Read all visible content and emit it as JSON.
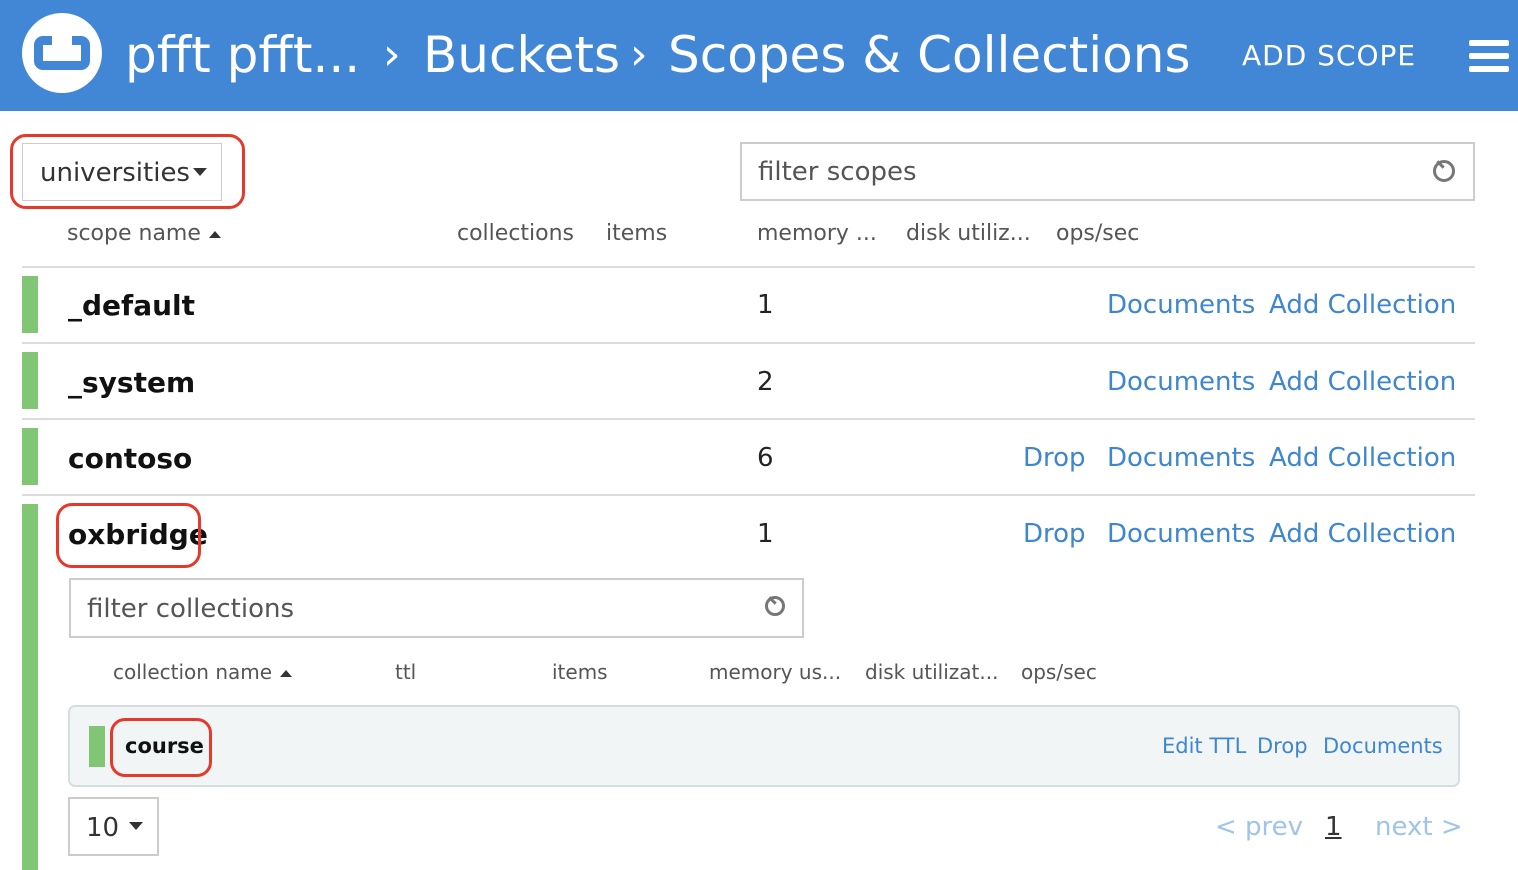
{
  "header": {
    "crumbs": [
      "pfft pfft...",
      "Buckets",
      "Scopes & Collections"
    ],
    "add_scope_label": "ADD SCOPE",
    "brand_color": "#4287d6"
  },
  "bucket_select": {
    "selected": "universities"
  },
  "scope_filter": {
    "placeholder": "filter scopes"
  },
  "scope_columns": [
    "scope name",
    "collections",
    "items",
    "memory ...",
    "disk utiliz...",
    "ops/sec"
  ],
  "scopes": [
    {
      "name": "_default",
      "count": "1",
      "actions": [
        "Documents",
        "Add Collection"
      ]
    },
    {
      "name": "_system",
      "count": "2",
      "actions": [
        "Documents",
        "Add Collection"
      ]
    },
    {
      "name": "contoso",
      "count": "6",
      "actions": [
        "Drop",
        "Documents",
        "Add Collection"
      ]
    },
    {
      "name": "oxbridge",
      "count": "1",
      "actions": [
        "Drop",
        "Documents",
        "Add Collection"
      ]
    }
  ],
  "collection_filter": {
    "placeholder": "filter collections"
  },
  "collection_columns": [
    "collection name",
    "ttl",
    "items",
    "memory us...",
    "disk utilizat...",
    "ops/sec"
  ],
  "collections": [
    {
      "name": "course",
      "actions": [
        "Edit TTL",
        "Drop",
        "Documents"
      ]
    }
  ],
  "pagination": {
    "page_size": "10",
    "prev": "< prev",
    "page": "1",
    "next": "next >"
  },
  "colors": {
    "status_ok": "#80c675",
    "link": "#3e86cf",
    "highlight": "#e53a2b"
  },
  "icons": {
    "logo": "couchbase-logo-icon",
    "menu": "hamburger-menu-icon",
    "search": "search-icon",
    "sort": "sort-ascending-icon",
    "dropdown": "caret-down-icon"
  }
}
